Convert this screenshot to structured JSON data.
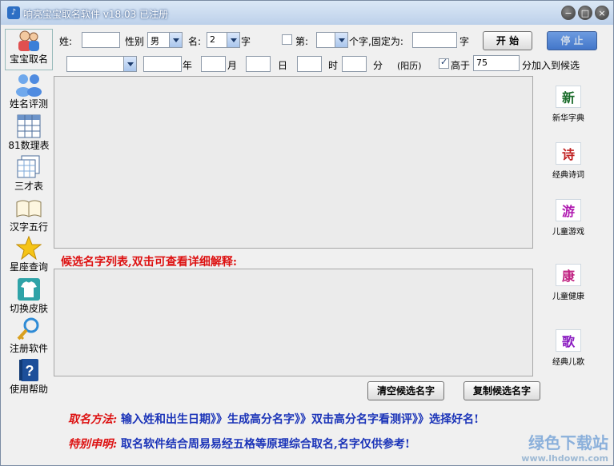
{
  "window": {
    "title": "响亮宝宝取名软件 v18.03  已注册",
    "minimize": "−",
    "maximize": "□",
    "close": "×"
  },
  "sidebar": [
    {
      "label": "宝宝取名",
      "icon": "baby-icon"
    },
    {
      "label": "姓名评测",
      "icon": "people-icon"
    },
    {
      "label": "81数理表",
      "icon": "table-icon"
    },
    {
      "label": "三才表",
      "icon": "sheets-icon"
    },
    {
      "label": "汉字五行",
      "icon": "book-icon"
    },
    {
      "label": "星座查询",
      "icon": "star-icon"
    },
    {
      "label": "切换皮肤",
      "icon": "shirt-icon"
    },
    {
      "label": "注册软件",
      "icon": "key-icon"
    },
    {
      "label": "使用帮助",
      "icon": "help-book-icon"
    }
  ],
  "row1": {
    "surname_label": "姓:",
    "surname_value": "",
    "gender_label": "性别",
    "gender_value": "男",
    "name_label": "名:",
    "name_len_value": "2",
    "name_len_suffix": "字",
    "fix_label": "第:",
    "fix_pos_value": "",
    "fix_char_label": "个字,固定为:",
    "fix_char_value": "",
    "fix_char_suffix": "字",
    "start_button": "开 始",
    "stop_button": "停 止"
  },
  "row2": {
    "calendar_value": "",
    "year_value": "",
    "year_label": "年",
    "month_value": "",
    "month_label": "月",
    "day_value": "",
    "day_label": "日",
    "hour_value": "",
    "hour_label": "时",
    "minute_value": "",
    "minute_label": "分",
    "calendar_note": "(阳历)",
    "score_check_label": "高于",
    "score_value": "75",
    "score_suffix": "分加入到候选"
  },
  "candidate_title": "候选名字列表,双击可查看详细解释:",
  "buttons": {
    "clear": "清空候选名字",
    "copy": "复制候选名字"
  },
  "right_tools": [
    {
      "glyph": "新",
      "label": "新华字典",
      "color": "#1a6b2a"
    },
    {
      "glyph": "诗",
      "label": "经典诗词",
      "color": "#c02020"
    },
    {
      "glyph": "游",
      "label": "儿童游戏",
      "color": "#b01ab0"
    },
    {
      "glyph": "康",
      "label": "儿童健康",
      "color": "#c02080"
    },
    {
      "glyph": "歌",
      "label": "经典儿歌",
      "color": "#8a1ac0"
    }
  ],
  "footer": {
    "method_key": "取名方法:",
    "method_text": "输入姓和出生日期》》生成高分名字》》双击高分名字看测评》》选择好名!",
    "notice_key": "特别申明:",
    "notice_text": "取名软件结合周易易经五格等原理综合取名,名字仅供参考!"
  },
  "watermark": {
    "brand": "绿色下载站",
    "url": "www.lhdown.com"
  }
}
